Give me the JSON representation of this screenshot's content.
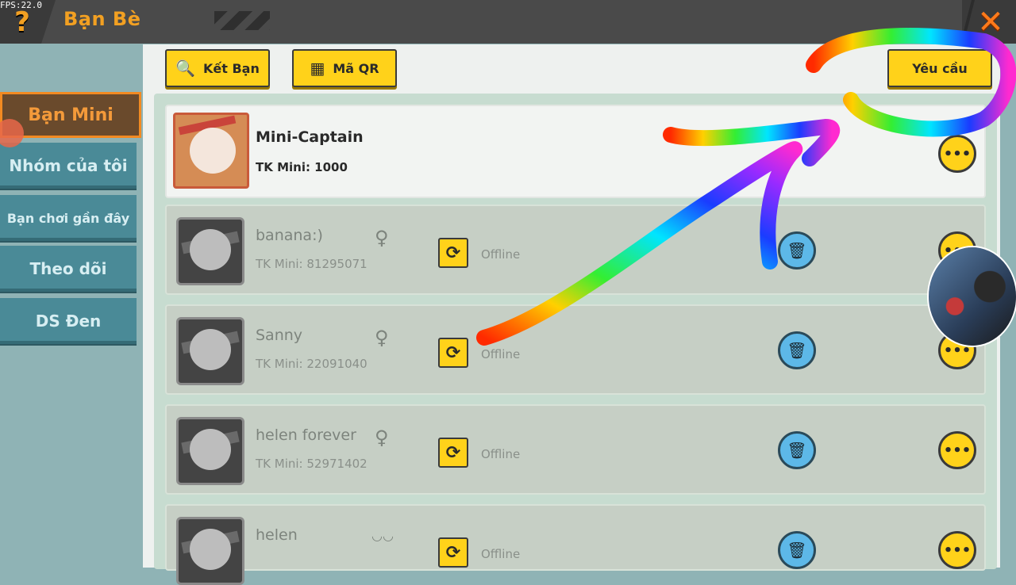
{
  "fps": "FPS:22.0",
  "header": {
    "title": "Bạn Bè",
    "help": "?",
    "close": "✕"
  },
  "sidebar": {
    "items": [
      {
        "label": "Bạn Mini",
        "active": true
      },
      {
        "label": "Nhóm của tôi",
        "active": false
      },
      {
        "label": "Bạn chơi gần đây",
        "active": false
      },
      {
        "label": "Theo dõi",
        "active": false
      },
      {
        "label": "DS Đen",
        "active": false
      }
    ]
  },
  "toolbar": {
    "add_friend": "Kết Bạn",
    "qr": "Mã QR",
    "requests": "Yêu cầu"
  },
  "friends": [
    {
      "name": "Mini-Captain",
      "tk": "TK Mini: 1000",
      "gender": "",
      "status": ""
    },
    {
      "name": "banana:)",
      "tk": "TK Mini: 81295071",
      "gender": "♀",
      "status": "Offline"
    },
    {
      "name": "Sanny",
      "tk": "TK Mini: 22091040",
      "gender": "♀",
      "status": "Offline"
    },
    {
      "name": "helen forever",
      "tk": "TK Mini: 52971402",
      "gender": "♀",
      "status": "Offline"
    },
    {
      "name": "helen",
      "tk": "",
      "gender": "",
      "status": "Offline"
    }
  ],
  "colors": {
    "accent": "#f2a022",
    "button_yellow": "#ffd21a",
    "trash_blue": "#5db8e8"
  }
}
